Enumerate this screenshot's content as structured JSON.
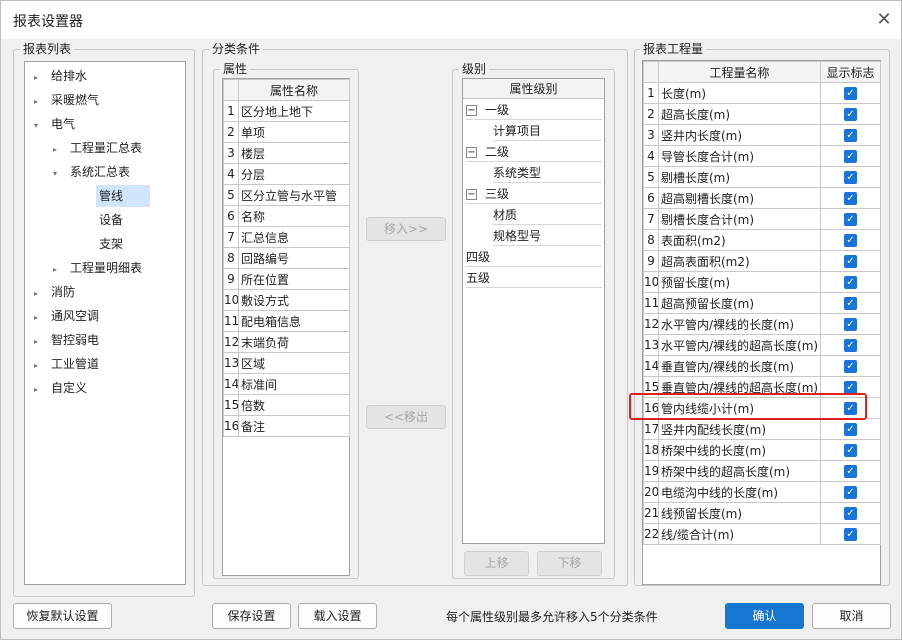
{
  "window": {
    "title": "报表设置器",
    "close_symbol": "✕"
  },
  "report_list": {
    "title": "报表列表",
    "items": [
      {
        "arrow": "▸",
        "label": "给排水"
      },
      {
        "arrow": "▸",
        "label": "采暖燃气"
      },
      {
        "arrow": "▾",
        "label": "电气"
      },
      {
        "arrow": "▸",
        "label": "工程量汇总表"
      },
      {
        "arrow": "▾",
        "label": "系统汇总表"
      },
      {
        "arrow": "",
        "label": "管线"
      },
      {
        "arrow": "",
        "label": "设备"
      },
      {
        "arrow": "",
        "label": "支架"
      },
      {
        "arrow": "▸",
        "label": "工程量明细表"
      },
      {
        "arrow": "▸",
        "label": "消防"
      },
      {
        "arrow": "▸",
        "label": "通风空调"
      },
      {
        "arrow": "▸",
        "label": "智控弱电"
      },
      {
        "arrow": "▸",
        "label": "工业管道"
      },
      {
        "arrow": "▸",
        "label": "自定义"
      }
    ]
  },
  "classify": {
    "title": "分类条件",
    "attr": {
      "title": "属性",
      "header": "属性名称",
      "rows": [
        {
          "n": "1",
          "name": "区分地上地下"
        },
        {
          "n": "2",
          "name": "单项"
        },
        {
          "n": "3",
          "name": "楼层"
        },
        {
          "n": "4",
          "name": "分层"
        },
        {
          "n": "5",
          "name": "区分立管与水平管"
        },
        {
          "n": "6",
          "name": "名称"
        },
        {
          "n": "7",
          "name": "汇总信息"
        },
        {
          "n": "8",
          "name": "回路编号"
        },
        {
          "n": "9",
          "name": "所在位置"
        },
        {
          "n": "10",
          "name": "敷设方式"
        },
        {
          "n": "11",
          "name": "配电箱信息"
        },
        {
          "n": "12",
          "name": "末端负荷"
        },
        {
          "n": "13",
          "name": "区域"
        },
        {
          "n": "14",
          "name": "标准间"
        },
        {
          "n": "15",
          "name": "倍数"
        },
        {
          "n": "16",
          "name": "备注"
        }
      ]
    },
    "move_in": "移入>>",
    "move_out": "<<移出",
    "level": {
      "title": "级别",
      "header": "属性级别",
      "items": [
        {
          "label": "一级",
          "pm": "−"
        },
        {
          "label": "计算项目",
          "child": true
        },
        {
          "label": "二级",
          "pm": "−"
        },
        {
          "label": "系统类型",
          "child": true
        },
        {
          "label": "三级",
          "pm": "−"
        },
        {
          "label": "材质",
          "child": true
        },
        {
          "label": "规格型号",
          "child": true
        },
        {
          "label": "四级"
        },
        {
          "label": "五级"
        }
      ]
    },
    "up": "上移",
    "down": "下移"
  },
  "quantity": {
    "title": "报表工程量",
    "col_name": "工程量名称",
    "col_show": "显示标志",
    "check": "✓",
    "rows": [
      {
        "n": "1",
        "name": "长度(m)"
      },
      {
        "n": "2",
        "name": "超高长度(m)"
      },
      {
        "n": "3",
        "name": "竖井内长度(m)"
      },
      {
        "n": "4",
        "name": "导管长度合计(m)"
      },
      {
        "n": "5",
        "name": "剔槽长度(m)"
      },
      {
        "n": "6",
        "name": "超高剔槽长度(m)"
      },
      {
        "n": "7",
        "name": "剔槽长度合计(m)"
      },
      {
        "n": "8",
        "name": "表面积(m2)"
      },
      {
        "n": "9",
        "name": "超高表面积(m2)"
      },
      {
        "n": "10",
        "name": "预留长度(m)"
      },
      {
        "n": "11",
        "name": "超高预留长度(m)"
      },
      {
        "n": "12",
        "name": "水平管内/裸线的长度(m)"
      },
      {
        "n": "13",
        "name": "水平管内/裸线的超高长度(m)"
      },
      {
        "n": "14",
        "name": "垂直管内/裸线的长度(m)"
      },
      {
        "n": "15",
        "name": "垂直管内/裸线的超高长度(m)"
      },
      {
        "n": "16",
        "name": "管内线缆小计(m)"
      },
      {
        "n": "17",
        "name": "竖井内配线长度(m)"
      },
      {
        "n": "18",
        "name": "桥架中线的长度(m)"
      },
      {
        "n": "19",
        "name": "桥架中线的超高长度(m)"
      },
      {
        "n": "20",
        "name": "电缆沟中线的长度(m)"
      },
      {
        "n": "21",
        "name": "线预留长度(m)"
      },
      {
        "n": "22",
        "name": "线/缆合计(m)"
      }
    ]
  },
  "footer": {
    "restore": "恢复默认设置",
    "save": "保存设置",
    "load": "载入设置",
    "note": "每个属性级别最多允许移入5个分类条件",
    "ok": "确认",
    "cancel": "取消"
  },
  "colors": {
    "accent": "#1677d2",
    "highlight": "#e02020",
    "selection": "#cfe5fb"
  }
}
